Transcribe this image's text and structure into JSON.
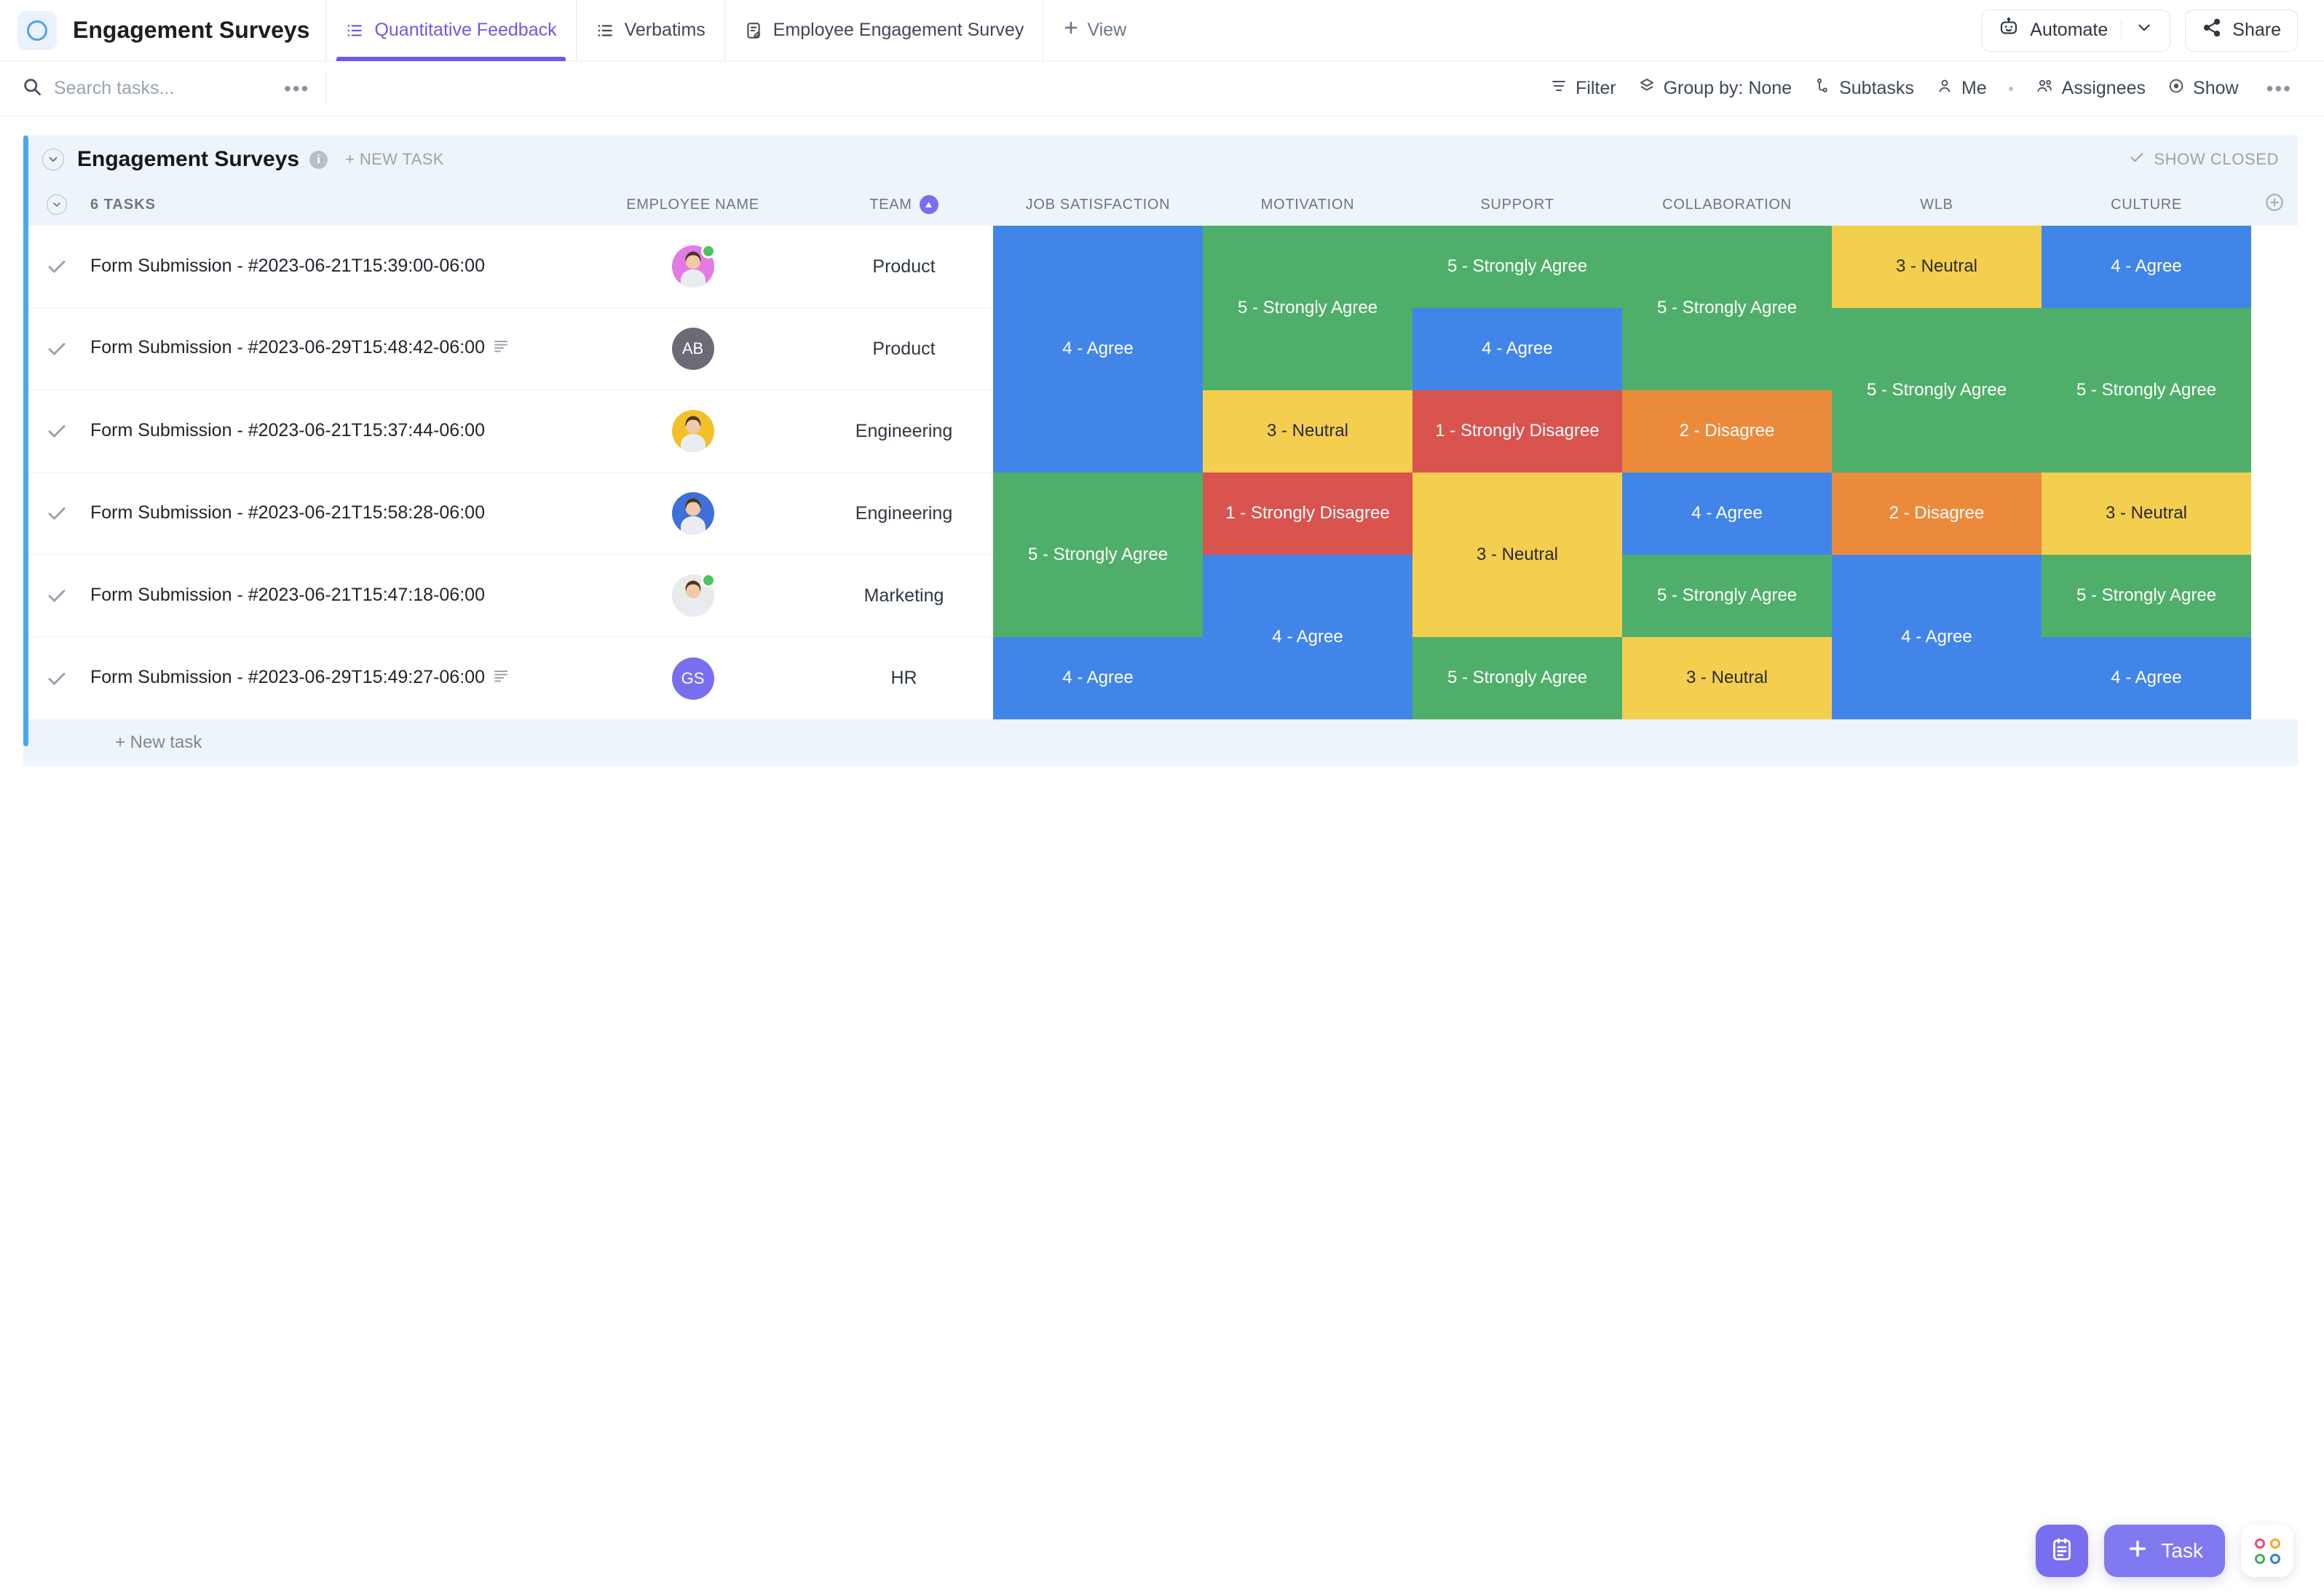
{
  "header": {
    "space_title": "Engagement Surveys",
    "logo_icon": "circle-ring-icon",
    "tabs": [
      {
        "label": "Quantitative Feedback",
        "icon": "list-view-icon",
        "active": true
      },
      {
        "label": "Verbatims",
        "icon": "list-view-icon",
        "active": false
      },
      {
        "label": "Employee Engagement Survey",
        "icon": "form-view-icon",
        "active": false
      }
    ],
    "add_view_label": "View",
    "automate_label": "Automate",
    "share_label": "Share"
  },
  "toolbar": {
    "search_placeholder": "Search tasks...",
    "search_value": "",
    "search_icon": "search-icon",
    "more_icon": "ellipsis-icon",
    "items": [
      {
        "label": "Filter",
        "icon": "filter-icon"
      },
      {
        "label": "Group by: None",
        "icon": "layers-icon"
      },
      {
        "label": "Subtasks",
        "icon": "subtask-icon"
      },
      {
        "label": "Me",
        "icon": "user-icon"
      },
      {
        "label": "Assignees",
        "icon": "users-icon"
      },
      {
        "label": "Show",
        "icon": "eye-circle-icon"
      }
    ],
    "overflow_icon": "ellipsis-icon"
  },
  "list": {
    "group_title": "Engagement Surveys",
    "info_icon": "info-icon",
    "new_task_label": "+ NEW TASK",
    "show_closed_label": "SHOW CLOSED",
    "show_closed_icon": "check-icon",
    "task_count_label": "6 TASKS",
    "add_column_icon": "plus-circle-icon",
    "footer_new_task_label": "+ New task",
    "columns": [
      {
        "key": "employee_name",
        "label": "EMPLOYEE NAME",
        "sorted": false
      },
      {
        "key": "team",
        "label": "TEAM",
        "sorted": true,
        "sort_dir": "asc"
      },
      {
        "key": "job_satisfaction",
        "label": "JOB SATISFACTION",
        "sorted": false
      },
      {
        "key": "motivation",
        "label": "MOTIVATION",
        "sorted": false
      },
      {
        "key": "support",
        "label": "SUPPORT",
        "sorted": false
      },
      {
        "key": "collaboration",
        "label": "COLLABORATION",
        "sorted": false
      },
      {
        "key": "wlb",
        "label": "WLB",
        "sorted": false
      },
      {
        "key": "culture",
        "label": "CULTURE",
        "sorted": false
      }
    ],
    "rows": [
      {
        "name": "Form Submission - #2023-06-21T15:39:00-06:00",
        "has_description": false,
        "status_icon": "check-icon",
        "avatar": {
          "type": "photo",
          "bg": "#e37ae6",
          "initials": "",
          "online": true
        },
        "team": "Product",
        "ratings": {
          "job_satisfaction": "4 - Agree",
          "motivation": "5 - Strongly Agree",
          "support": "5 - Strongly Agree",
          "collaboration": "5 - Strongly Agree",
          "wlb": "3 - Neutral",
          "culture": "4 - Agree"
        }
      },
      {
        "name": "Form Submission - #2023-06-29T15:48:42-06:00",
        "has_description": true,
        "status_icon": "check-icon",
        "avatar": {
          "type": "initials",
          "bg": "#6b6b75",
          "initials": "AB",
          "online": false
        },
        "team": "Product",
        "ratings": {
          "job_satisfaction": "4 - Agree",
          "motivation": "5 - Strongly Agree",
          "support": "4 - Agree",
          "collaboration": "5 - Strongly Agree",
          "wlb": "5 - Strongly Agree",
          "culture": "5 - Strongly Agree"
        }
      },
      {
        "name": "Form Submission - #2023-06-21T15:37:44-06:00",
        "has_description": false,
        "status_icon": "check-icon",
        "avatar": {
          "type": "photo",
          "bg": "#f3c02a",
          "initials": "",
          "online": false
        },
        "team": "Engineering",
        "ratings": {
          "job_satisfaction": "4 - Agree",
          "motivation": "3 - Neutral",
          "support": "1 - Strongly Disagree",
          "collaboration": "2 - Disagree",
          "wlb": "5 - Strongly Agree",
          "culture": "5 - Strongly Agree"
        }
      },
      {
        "name": "Form Submission - #2023-06-21T15:58:28-06:00",
        "has_description": false,
        "status_icon": "check-icon",
        "avatar": {
          "type": "photo",
          "bg": "#3f6fd8",
          "initials": "",
          "online": false
        },
        "team": "Engineering",
        "ratings": {
          "job_satisfaction": "5 - Strongly Agree",
          "motivation": "1 - Strongly Disagree",
          "support": "3 - Neutral",
          "collaboration": "4 - Agree",
          "wlb": "2 - Disagree",
          "culture": "3 - Neutral"
        }
      },
      {
        "name": "Form Submission - #2023-06-21T15:47:18-06:00",
        "has_description": false,
        "status_icon": "check-icon",
        "avatar": {
          "type": "photo",
          "bg": "#e9ebe8",
          "initials": "",
          "online": true
        },
        "team": "Marketing",
        "ratings": {
          "job_satisfaction": "5 - Strongly Agree",
          "motivation": "4 - Agree",
          "support": "3 - Neutral",
          "collaboration": "5 - Strongly Agree",
          "wlb": "4 - Agree",
          "culture": "5 - Strongly Agree"
        }
      },
      {
        "name": "Form Submission - #2023-06-29T15:49:27-06:00",
        "has_description": true,
        "status_icon": "check-icon",
        "avatar": {
          "type": "initials",
          "bg": "#7a6ef0",
          "initials": "GS",
          "online": false
        },
        "team": "HR",
        "ratings": {
          "job_satisfaction": "4 - Agree",
          "motivation": "4 - Agree",
          "support": "5 - Strongly Agree",
          "collaboration": "3 - Neutral",
          "wlb": "4 - Agree",
          "culture": "4 - Agree"
        }
      }
    ]
  },
  "rating_colors": {
    "1 - Strongly Disagree": "#d9534f",
    "2 - Disagree": "#ec8a3c",
    "3 - Neutral": "#f4ce4f",
    "4 - Agree": "#4285e8",
    "5 - Strongly Agree": "#4faf6a"
  },
  "rating_dark_text": [
    "3 - Neutral"
  ],
  "fab": {
    "doc_icon": "notepad-icon",
    "task_label": "Task",
    "task_icon": "plus-icon",
    "apps_icon": "apps-grid-icon"
  },
  "accent_color": "#49a9f0",
  "brand_purple": "#7a6ef0"
}
